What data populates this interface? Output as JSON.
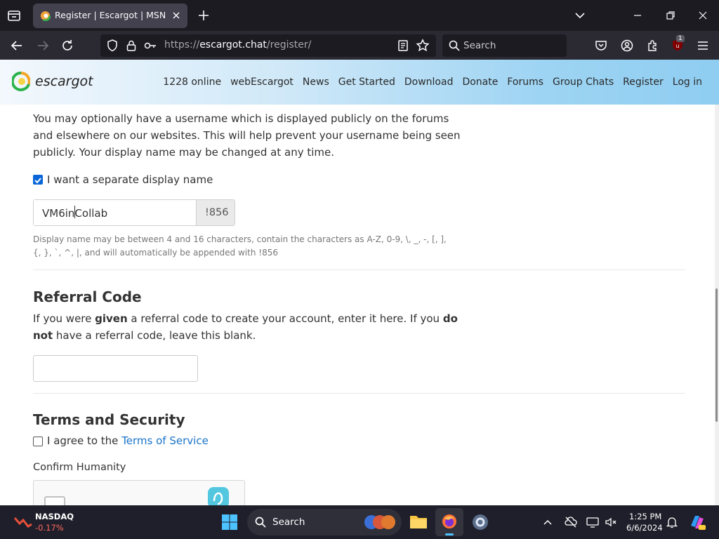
{
  "browser": {
    "tab_title": "Register | Escargot | MSN Messenger",
    "url_prefix": "https://",
    "url_host": "escargot.chat",
    "url_path": "/register/",
    "search_placeholder": "Search",
    "extension_badge": "1"
  },
  "site": {
    "logo_text": "escargot",
    "nav": [
      "1228 online",
      "webEscargot",
      "News",
      "Get Started",
      "Download",
      "Donate",
      "Forums",
      "Group Chats",
      "Register",
      "Log in"
    ]
  },
  "form": {
    "display_name_intro": "You may optionally have a username which is displayed publicly on the forums and elsewhere on our websites. This will help prevent your username being seen publicly. Your display name may be changed at any time.",
    "separate_display_name_label": "I want a separate display name",
    "separate_display_name_checked": true,
    "display_name_value": "VM6inCollab",
    "display_name_suffix": "!856",
    "display_name_help": "Display name may be between 4 and 16 characters, contain the characters as A-Z, 0-9, \\, _, -, [, ], {, }, `, ^, |, and will automatically be appended with !856",
    "referral_heading": "Referral Code",
    "referral_text_1": "If you were ",
    "referral_bold_1": "given",
    "referral_text_2": " a referral code to create your account, enter it here. If you ",
    "referral_bold_2": "do not",
    "referral_text_3": " have a referral code, leave this blank.",
    "referral_value": "",
    "terms_heading": "Terms and Security",
    "terms_label": "I agree to the ",
    "terms_link": "Terms of Service",
    "terms_checked": false,
    "humanity_label": "Confirm Humanity"
  },
  "taskbar": {
    "stock_name": "NASDAQ",
    "stock_change": "-0.17%",
    "search_placeholder": "Search",
    "time": "1:25 PM",
    "date": "6/6/2024"
  },
  "colors": {
    "accent": "#0a66d8",
    "link": "#1a73c8",
    "stock_negative": "#ff6a5c"
  }
}
